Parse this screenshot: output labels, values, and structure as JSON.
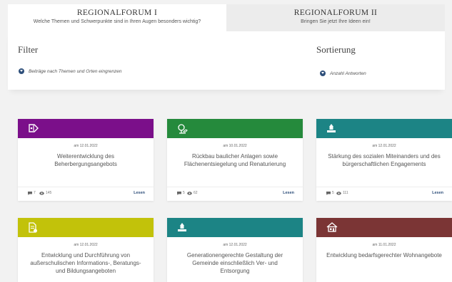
{
  "tabs": [
    {
      "title": "REGIONALFORUM I",
      "subtitle": "Welche Themen und Schwerpunkte sind in Ihren Augen besonders wichtig?"
    },
    {
      "title": "REGIONALFORUM II",
      "subtitle": "Bringen Sie jetzt Ihre Ideen ein!"
    }
  ],
  "filter": {
    "heading": "Filter",
    "link": "Beiträge nach Themen und Orten eingrenzen"
  },
  "sorting": {
    "heading": "Sortierung",
    "link": "Anzahl Antworten"
  },
  "read_label": "Lesen",
  "colors": {
    "purple": "#7b0f8a",
    "green": "#258a3c",
    "teal": "#1c8485",
    "lime": "#c2c20a",
    "maroon": "#7b3535",
    "accent": "#2e4f7a"
  },
  "cards": [
    {
      "date": "am 12.01.2022",
      "title": "Weiterentwicklung des Beherbergungsangebots",
      "comments": "7",
      "views": "145",
      "icon": "tag-icon"
    },
    {
      "date": "am 10.01.2022",
      "title": "Rückbau baulicher Anlagen sowie Flächenentsiegelung und Renaturierung",
      "comments": "5",
      "views": "62",
      "icon": "plant-icon"
    },
    {
      "date": "am 12.01.2022",
      "title": "Stärkung des sozialen Miteinanders und des bürgerschaftlichen Engagements",
      "comments": "5",
      "views": "111",
      "icon": "community-icon"
    },
    {
      "date": "am 12.01.2022",
      "title": "Entwicklung und Durchführung von außerschulischen Informations-, Beratungs- und Bildungsangeboten",
      "icon": "document-icon"
    },
    {
      "date": "am 12.01.2022",
      "title": "Generationengerechte Gestaltung der Gemeinde einschließlich Ver- und Entsorgung",
      "icon": "community-icon"
    },
    {
      "date": "am 11.01.2022",
      "title": "Entwicklung bedarfsgerechter Wohnangebote",
      "icon": "house-icon"
    }
  ]
}
